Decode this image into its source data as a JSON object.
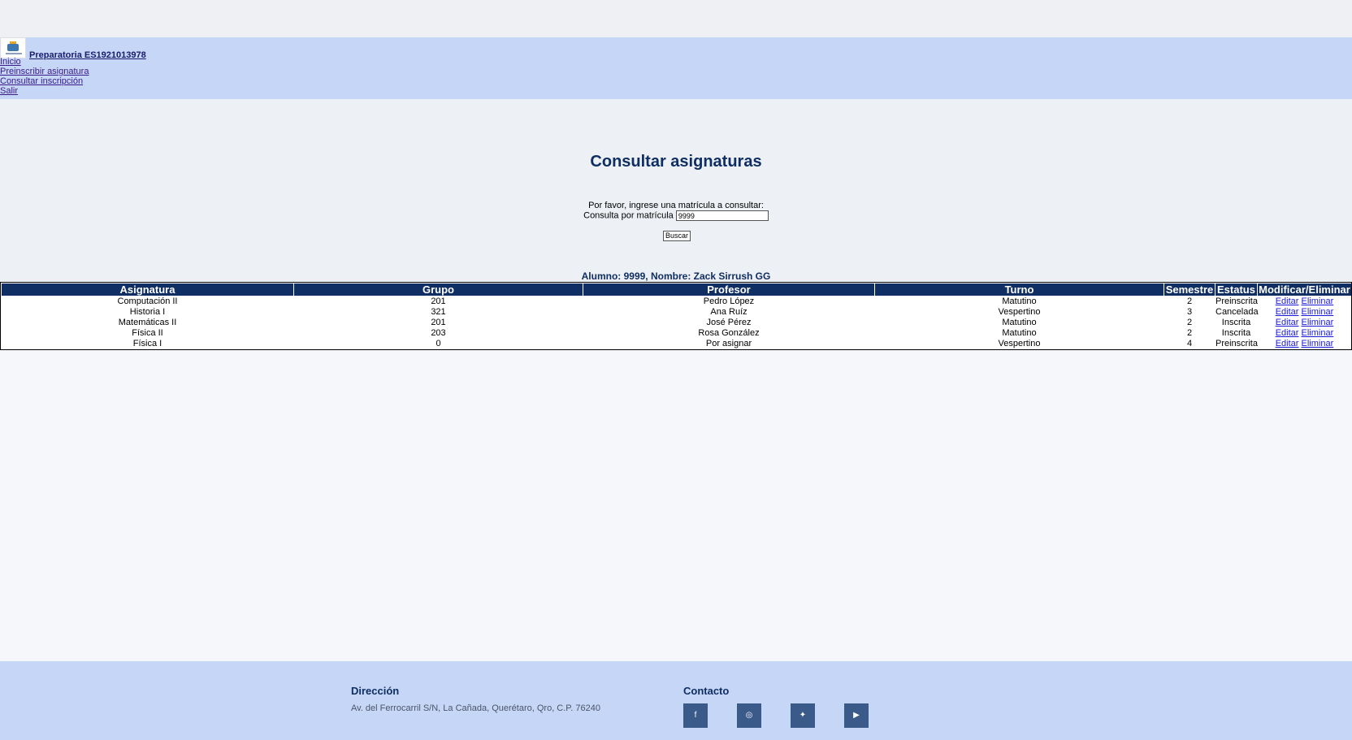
{
  "header": {
    "brand": "Preparatoria ES1921013978",
    "nav": [
      "Inicio",
      "Preinscribir asignatura",
      "Consultar inscripción",
      "Salir"
    ]
  },
  "main": {
    "title": "Consultar asignaturas",
    "prompt": "Por favor, ingrese una matrícula a consultar:",
    "query_label": "Consulta por matrícula",
    "query_value": "9999",
    "search_button": "Buscar",
    "student_info": "Alumno: 9999, Nombre: Zack Sirrush GG"
  },
  "table": {
    "headers": [
      "Asignatura",
      "Grupo",
      "Profesor",
      "Turno",
      "Semestre",
      "Estatus",
      "Modificar/Eliminar"
    ],
    "rows": [
      [
        "Computación II",
        "201",
        "Pedro López",
        "Matutino",
        "2",
        "Preinscrita"
      ],
      [
        "Historia I",
        "321",
        "Ana Ruíz",
        "Vespertino",
        "3",
        "Cancelada"
      ],
      [
        "Matemáticas II",
        "201",
        "José Pérez",
        "Matutino",
        "2",
        "Inscrita"
      ],
      [
        "Física II",
        "203",
        "Rosa González",
        "Matutino",
        "2",
        "Inscrita"
      ],
      [
        "Física I",
        "0",
        "Por asignar",
        "Vespertino",
        "4",
        "Preinscrita"
      ]
    ],
    "edit_label": "Editar",
    "delete_label": "Eliminar"
  },
  "footer": {
    "address_title": "Dirección",
    "address": "Av. del Ferrocarril S/N, La Cañada, Querétaro, Qro, C.P. 76240",
    "contact_title": "Contacto",
    "social": [
      {
        "name": "facebook-icon",
        "glyph": "f"
      },
      {
        "name": "instagram-icon",
        "glyph": "◎"
      },
      {
        "name": "twitter-icon",
        "glyph": "✦"
      },
      {
        "name": "youtube-icon",
        "glyph": "▶"
      }
    ]
  },
  "colors": {
    "header_bg": "#c5d6f6",
    "accent": "#0f2e63",
    "link": "#1a1ad9"
  }
}
